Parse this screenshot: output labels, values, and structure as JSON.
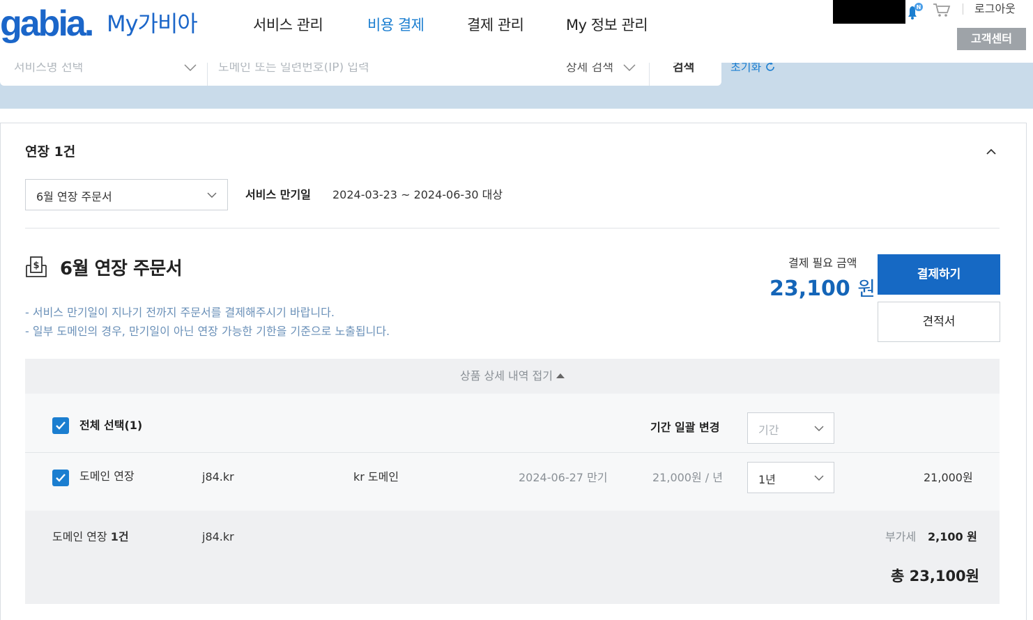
{
  "header": {
    "logo": "gabia.",
    "logo_sub": "My가비아",
    "nav": [
      "서비스 관리",
      "비용 결제",
      "결제 관리",
      "My 정보 관리"
    ],
    "active_nav": "비용 결제",
    "notification_badge": "N",
    "logout": "로그아웃",
    "customer_center": "고객센터"
  },
  "search": {
    "service_select_placeholder": "서비스명 선택",
    "query_placeholder": "도메인 또는 일련번호(IP) 입력",
    "advanced_search": "상세 검색",
    "search_button": "검색",
    "reset": "초기화"
  },
  "renewal": {
    "title": "연장 1건",
    "order_select_value": "6월 연장 주문서",
    "expiry_label": "서비스 만기일",
    "expiry_range": "2024-03-23 ~ 2024-06-30 대상"
  },
  "order": {
    "title": "6월 연장 주문서",
    "notes": [
      "- 서비스 만기일이 지나기 전까지 주문서를 결제해주시기 바랍니다.",
      "- 일부 도메인의 경우, 만기일이 아닌 연장 가능한 기한을 기준으로 노출됩니다."
    ],
    "amount_label": "결제 필요 금액",
    "amount": "23,100",
    "amount_unit": "원",
    "pay_button": "결제하기",
    "quote_button": "견적서"
  },
  "details": {
    "toggle_label": "상품 상세 내역 접기",
    "select_all_label": "전체 선택(1)",
    "bulk_period_label": "기간 일괄 변경",
    "bulk_period_placeholder": "기간",
    "items": [
      {
        "type": "도메인 연장",
        "domain": "j84.kr",
        "product": "kr 도메인",
        "expiry": "2024-06-27 만기",
        "unit_price": "21,000원 / 년",
        "period": "1년",
        "price": "21,000원"
      }
    ]
  },
  "summary": {
    "label_prefix": "도메인 연장 ",
    "label_count": "1건",
    "domain": "j84.kr",
    "vat_label": "부가세",
    "vat_value": "2,100 원",
    "total": "총 23,100원"
  },
  "colors": {
    "brand": "#1b66c9",
    "primary_button": "#1669c4",
    "amount": "#1465b8",
    "note": "#6a90b8",
    "search_band": "#c9dbea"
  }
}
